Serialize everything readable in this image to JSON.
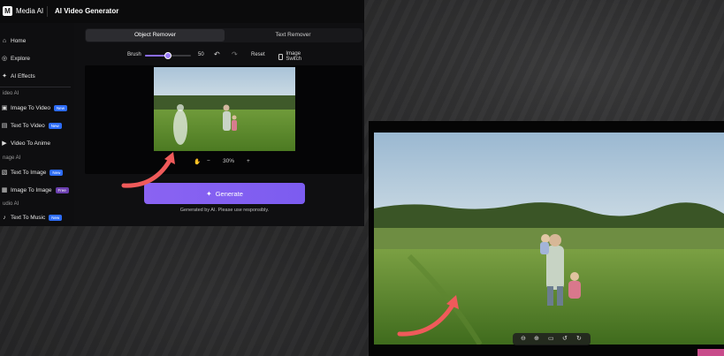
{
  "app": {
    "brand": "Media AI",
    "title": "AI Video Generator"
  },
  "sidebar": {
    "items": [
      {
        "label": "Home",
        "icon": "home-icon"
      },
      {
        "label": "Explore",
        "icon": "compass-icon"
      },
      {
        "label": "AI Effects",
        "icon": "sparkle-icon"
      }
    ],
    "sections": [
      {
        "title": "ideo AI",
        "items": [
          {
            "label": "Image To Video",
            "badge": "New"
          },
          {
            "label": "Text To Video",
            "badge": "New"
          },
          {
            "label": "Video To Anime",
            "badge": ""
          }
        ]
      },
      {
        "title": "nage AI",
        "items": [
          {
            "label": "Text To Image",
            "badge": "New"
          },
          {
            "label": "Image To Image",
            "badge": "Free"
          }
        ]
      },
      {
        "title": "udio AI",
        "items": [
          {
            "label": "Text To Music",
            "badge": "New"
          }
        ]
      }
    ]
  },
  "tabs": [
    {
      "label": "Object Remover",
      "active": true
    },
    {
      "label": "Text Remover",
      "active": false
    }
  ],
  "toolbar": {
    "brush_label": "Brush",
    "brush_value": "50",
    "brush_fraction": 0.5,
    "reset_label": "Reset",
    "image_switch_label": "Image Switch"
  },
  "zoom": {
    "value": "30%",
    "minus": "−",
    "plus": "+"
  },
  "generate": {
    "label": "Generate",
    "disclaimer": "Generated by AI. Please use responsibly."
  },
  "colors": {
    "accent": "#8a63f2",
    "new_badge": "#2d6cf6",
    "arrow": "#ef5a5a"
  }
}
